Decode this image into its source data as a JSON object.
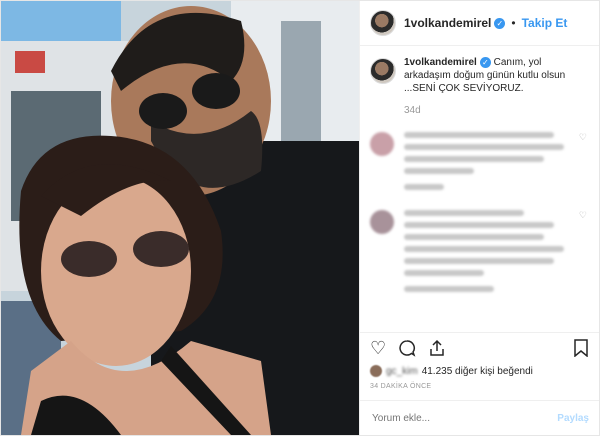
{
  "header": {
    "username": "1volkandemirel",
    "verified_glyph": "✓",
    "separator": "•",
    "follow_label": "Takip Et"
  },
  "caption": {
    "username": "1volkandemirel",
    "text": "Canım, yol arkadaşım doğum günün kutlu olsun ...SENİ ÇOK SEVİYORUZ.",
    "age": "34d"
  },
  "likes": {
    "text": "41.235 diğer kişi beğendi"
  },
  "timestamp": "34 DAKİKA ÖNCE",
  "comment_box": {
    "placeholder": "Yorum ekle...",
    "post_label": "Paylaş"
  },
  "icons": [
    "heart-icon",
    "comment-icon",
    "share-icon",
    "bookmark-icon"
  ],
  "colors": {
    "accent": "#3897f0",
    "text": "#262626",
    "muted": "#999999"
  }
}
